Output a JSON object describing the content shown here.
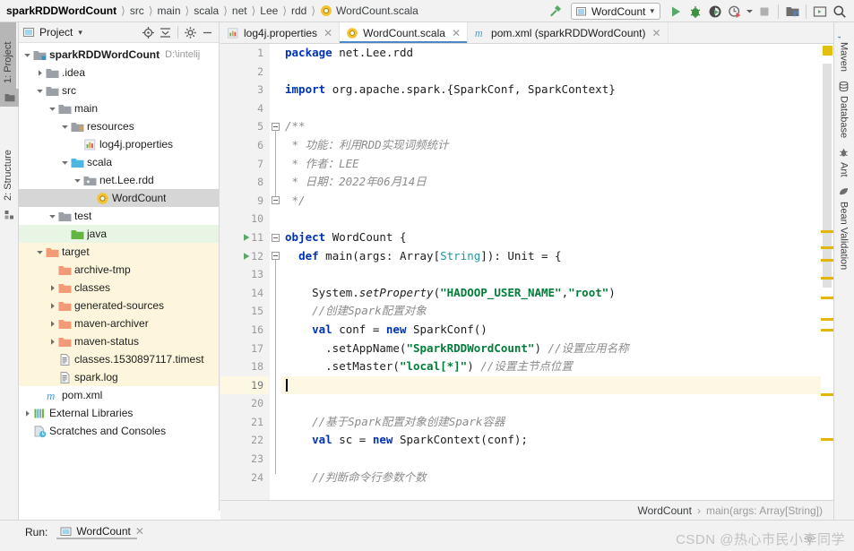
{
  "breadcrumb": {
    "items": [
      "sparkRDDWordCount",
      "src",
      "main",
      "scala",
      "net",
      "Lee",
      "rdd"
    ],
    "file": "WordCount.scala"
  },
  "toolbar": {
    "build_icon": "hammer-icon",
    "run_config": "WordCount",
    "dropdown_caret": "▾",
    "run_icon": "run-icon",
    "debug_icon": "debug-bug-icon",
    "coverage_icon": "run-with-coverage-icon",
    "profiler_icon": "profiler-icon",
    "stop_icon": "stop-icon",
    "project_structure_icon": "project-structure-icon",
    "terminal_icon": "terminal-icon",
    "search_icon": "search-icon"
  },
  "left_rail": {
    "project_tab": "1: Project",
    "structure_tab": "2: Structure"
  },
  "project_panel": {
    "title": "Project",
    "caret": "▾",
    "icons": [
      "locate-icon",
      "collapse-all-icon",
      "settings-gear-icon",
      "hide-icon"
    ],
    "tree": [
      {
        "depth": 0,
        "arrow": "down",
        "icon": "module-folder-icon",
        "label": "sparkRDDWordCount",
        "path": "D:\\intelij",
        "bold": true
      },
      {
        "depth": 1,
        "arrow": "right",
        "icon": "folder-icon",
        "label": ".idea"
      },
      {
        "depth": 1,
        "arrow": "down",
        "icon": "folder-icon",
        "label": "src"
      },
      {
        "depth": 2,
        "arrow": "down",
        "icon": "folder-icon",
        "label": "main"
      },
      {
        "depth": 3,
        "arrow": "down",
        "icon": "resources-folder-icon",
        "label": "resources"
      },
      {
        "depth": 4,
        "arrow": "none",
        "icon": "properties-file-icon",
        "label": "log4j.properties"
      },
      {
        "depth": 3,
        "arrow": "down",
        "icon": "source-folder-icon",
        "label": "scala"
      },
      {
        "depth": 4,
        "arrow": "down",
        "icon": "package-icon",
        "label": "net.Lee.rdd"
      },
      {
        "depth": 5,
        "arrow": "none",
        "icon": "scala-object-icon",
        "label": "WordCount",
        "state": "selected"
      },
      {
        "depth": 2,
        "arrow": "down",
        "icon": "folder-icon",
        "label": "test"
      },
      {
        "depth": 3,
        "arrow": "none",
        "icon": "test-source-folder-icon",
        "label": "java",
        "state": "test-source"
      },
      {
        "depth": 1,
        "arrow": "down",
        "icon": "excluded-folder-icon",
        "label": "target",
        "state": "excluded"
      },
      {
        "depth": 2,
        "arrow": "none",
        "icon": "excluded-folder-icon",
        "label": "archive-tmp",
        "state": "excluded"
      },
      {
        "depth": 2,
        "arrow": "right",
        "icon": "excluded-folder-icon",
        "label": "classes",
        "state": "excluded"
      },
      {
        "depth": 2,
        "arrow": "right",
        "icon": "excluded-folder-icon",
        "label": "generated-sources",
        "state": "excluded"
      },
      {
        "depth": 2,
        "arrow": "right",
        "icon": "excluded-folder-icon",
        "label": "maven-archiver",
        "state": "excluded"
      },
      {
        "depth": 2,
        "arrow": "right",
        "icon": "excluded-folder-icon",
        "label": "maven-status",
        "state": "excluded"
      },
      {
        "depth": 2,
        "arrow": "none",
        "icon": "text-file-icon",
        "label": "classes.1530897117.timest",
        "state": "excluded"
      },
      {
        "depth": 2,
        "arrow": "none",
        "icon": "text-file-icon",
        "label": "spark.log",
        "state": "excluded"
      },
      {
        "depth": 1,
        "arrow": "none",
        "icon": "maven-xml-icon",
        "label": "pom.xml"
      },
      {
        "depth": 0,
        "arrow": "right",
        "icon": "libraries-icon",
        "label": "External Libraries"
      },
      {
        "depth": 0,
        "arrow": "none",
        "icon": "scratches-icon",
        "label": "Scratches and Consoles"
      }
    ]
  },
  "editor": {
    "tabs": [
      {
        "label": "log4j.properties",
        "icon": "properties-file-icon",
        "active": false
      },
      {
        "label": "WordCount.scala",
        "icon": "scala-object-icon",
        "active": true
      },
      {
        "label": "pom.xml (sparkRDDWordCount)",
        "icon": "maven-xml-icon",
        "active": false
      }
    ],
    "current_line": 19,
    "lines": [
      {
        "n": 1,
        "tokens": [
          {
            "t": "package ",
            "c": "kw"
          },
          {
            "t": "net.Lee.rdd",
            "c": "plain"
          }
        ]
      },
      {
        "n": 2,
        "tokens": []
      },
      {
        "n": 3,
        "tokens": [
          {
            "t": "import ",
            "c": "kw"
          },
          {
            "t": "org.apache.spark.{SparkConf, SparkContext}",
            "c": "plain"
          }
        ]
      },
      {
        "n": 4,
        "tokens": []
      },
      {
        "n": 5,
        "tokens": [
          {
            "t": "/**",
            "c": "cmt"
          }
        ]
      },
      {
        "n": 6,
        "tokens": [
          {
            "t": " * 功能：利用RDD实现词频统计",
            "c": "cmt"
          }
        ]
      },
      {
        "n": 7,
        "tokens": [
          {
            "t": " * 作者：LEE",
            "c": "cmt"
          }
        ]
      },
      {
        "n": 8,
        "tokens": [
          {
            "t": " * 日期：2022年06月14日",
            "c": "cmt"
          }
        ]
      },
      {
        "n": 9,
        "tokens": [
          {
            "t": " */",
            "c": "cmt"
          }
        ]
      },
      {
        "n": 10,
        "tokens": []
      },
      {
        "n": 11,
        "tokens": [
          {
            "t": "object ",
            "c": "kw"
          },
          {
            "t": "WordCount {",
            "c": "plain"
          }
        ],
        "run_marker": true
      },
      {
        "n": 12,
        "tokens": [
          {
            "t": "  ",
            "c": "plain"
          },
          {
            "t": "def ",
            "c": "kw"
          },
          {
            "t": "main(args: Array[",
            "c": "plain"
          },
          {
            "t": "String",
            "c": "typ"
          },
          {
            "t": "]): Unit = {",
            "c": "plain"
          }
        ],
        "run_marker": true
      },
      {
        "n": 13,
        "tokens": []
      },
      {
        "n": 14,
        "tokens": [
          {
            "t": "    System.",
            "c": "plain"
          },
          {
            "t": "setProperty",
            "c": "ital"
          },
          {
            "t": "(",
            "c": "plain"
          },
          {
            "t": "\"HADOOP_USER_NAME\"",
            "c": "str"
          },
          {
            "t": ",",
            "c": "plain"
          },
          {
            "t": "\"root\"",
            "c": "str"
          },
          {
            "t": ")",
            "c": "plain"
          }
        ]
      },
      {
        "n": 15,
        "tokens": [
          {
            "t": "    //创建Spark配置对象",
            "c": "cmt"
          }
        ]
      },
      {
        "n": 16,
        "tokens": [
          {
            "t": "    ",
            "c": "plain"
          },
          {
            "t": "val ",
            "c": "kw"
          },
          {
            "t": "conf = ",
            "c": "plain"
          },
          {
            "t": "new ",
            "c": "kw"
          },
          {
            "t": "SparkConf()",
            "c": "plain"
          }
        ]
      },
      {
        "n": 17,
        "tokens": [
          {
            "t": "      .setAppName(",
            "c": "plain"
          },
          {
            "t": "\"SparkRDDWordCount\"",
            "c": "str"
          },
          {
            "t": ") ",
            "c": "plain"
          },
          {
            "t": "//设置应用名称",
            "c": "cmt"
          }
        ]
      },
      {
        "n": 18,
        "tokens": [
          {
            "t": "      .setMaster(",
            "c": "plain"
          },
          {
            "t": "\"local[*]\"",
            "c": "str"
          },
          {
            "t": ") ",
            "c": "plain"
          },
          {
            "t": "//设置主节点位置",
            "c": "cmt"
          }
        ]
      },
      {
        "n": 19,
        "tokens": [],
        "caret": true
      },
      {
        "n": 20,
        "tokens": []
      },
      {
        "n": 21,
        "tokens": [
          {
            "t": "    //基于Spark配置对象创建Spark容器",
            "c": "cmt"
          }
        ]
      },
      {
        "n": 22,
        "tokens": [
          {
            "t": "    ",
            "c": "plain"
          },
          {
            "t": "val ",
            "c": "kw"
          },
          {
            "t": "sc = ",
            "c": "plain"
          },
          {
            "t": "new ",
            "c": "kw"
          },
          {
            "t": "SparkContext(conf);",
            "c": "plain"
          }
        ]
      },
      {
        "n": 23,
        "tokens": []
      },
      {
        "n": 24,
        "tokens": [
          {
            "t": "    //判断命令行参数个数",
            "c": "cmt"
          }
        ]
      }
    ],
    "breadcrumb_bottom": {
      "class": "WordCount",
      "separator": "›",
      "method": "main(args: Array[String])"
    }
  },
  "right_rail": {
    "tabs": [
      {
        "label": "Maven",
        "icon": "maven-icon"
      },
      {
        "label": "Database",
        "icon": "database-icon"
      },
      {
        "label": "Ant",
        "icon": "ant-icon"
      },
      {
        "label": "Bean Validation",
        "icon": "bean-validation-icon"
      }
    ]
  },
  "bottom": {
    "run_label": "Run:",
    "run_tab": "WordCount",
    "close": "✕"
  },
  "watermark": {
    "text": "CSDN @热心市民小李同学"
  },
  "colors": {
    "accent_blue": "#4a88c7",
    "keyword": "#0033b3",
    "string": "#027d39",
    "comment": "#8c8c8c",
    "type": "#20999d",
    "warning_marker": "#e3b505",
    "current_line": "#fdf8e4",
    "excluded_folder": "#fdf6dc",
    "test_source": "#e9f5e4"
  }
}
